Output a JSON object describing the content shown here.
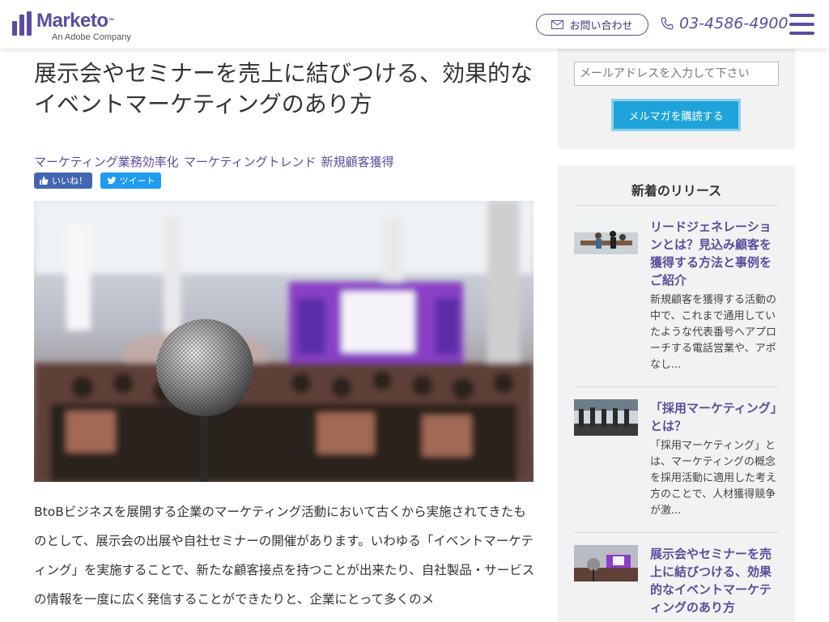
{
  "header": {
    "logo_word": "Marketo",
    "logo_tm": "™",
    "logo_sub": "An Adobe Company",
    "contact_label": "お問い合わせ",
    "phone": "03-4586-4900"
  },
  "article": {
    "title": "展示会やセミナーを売上に結びつける、効果的なイベントマーケティングのあり方",
    "tags": [
      "マーケティング業務効率化",
      "マーケティングトレンド",
      "新規顧客獲得"
    ],
    "like_label": "いいね！",
    "tweet_label": "ツイート",
    "body": "BtoBビジネスを展開する企業のマーケティング活動において古くから実施されてきたものとして、展示会の出展や自社セミナーの開催があります。いわゆる「イベントマーケティング」を実施することで、新たな顧客接点を持つことが出来たり、自社製品・サービスの情報を一度に広く発信することができたりと、企業にとって多くのメ"
  },
  "newsletter": {
    "email_placeholder": "メールアドレスを入力して下さい",
    "subscribe_label": "メルマガを購読する"
  },
  "releases": {
    "heading": "新着のリリース",
    "items": [
      {
        "title": "リードジェネレーションとは？見込み顧客を獲得する方法と事例をご紹介",
        "desc": "新規顧客を獲得する活動の中で、これまで通用していたような代表番号へアプローチする電話営業や、アポなし..."
      },
      {
        "title": "「採用マーケティング」とは？",
        "desc": "「採用マーケティング」とは、マーケティングの概念を採用活動に適用した考え方のことで、人材獲得競争が激..."
      },
      {
        "title": "展示会やセミナーを売上に結びつける、効果的なイベントマーケティングのあり方",
        "desc": ""
      }
    ]
  },
  "colors": {
    "brand": "#5c4c9f",
    "button_blue": "#1ea4db",
    "facebook": "#4267b2",
    "twitter": "#1d9bf0"
  }
}
